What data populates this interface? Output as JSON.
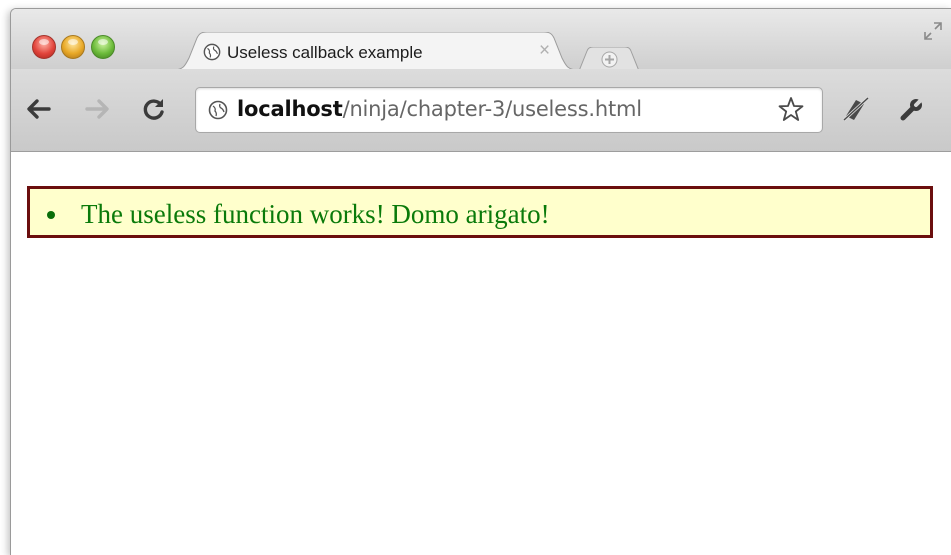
{
  "tab": {
    "title": "Useless callback example",
    "close": "×",
    "favicon": "globe-icon"
  },
  "toolbar": {
    "back": "back-arrow-icon",
    "forward": "forward-arrow-icon",
    "reload": "reload-icon",
    "extension": "extension-icon",
    "menu": "wrench-icon"
  },
  "address": {
    "host": "localhost",
    "path": "/ninja/chapter-3/useless.html",
    "icon": "globe-icon",
    "bookmark": "star-icon"
  },
  "content": {
    "results": [
      {
        "text": "The useless function works! Domo arigato!",
        "status": "pass"
      }
    ]
  },
  "colors": {
    "pass_text": "#0a7a0a",
    "results_background": "#ffffcc",
    "results_border": "#6b0e0e"
  }
}
